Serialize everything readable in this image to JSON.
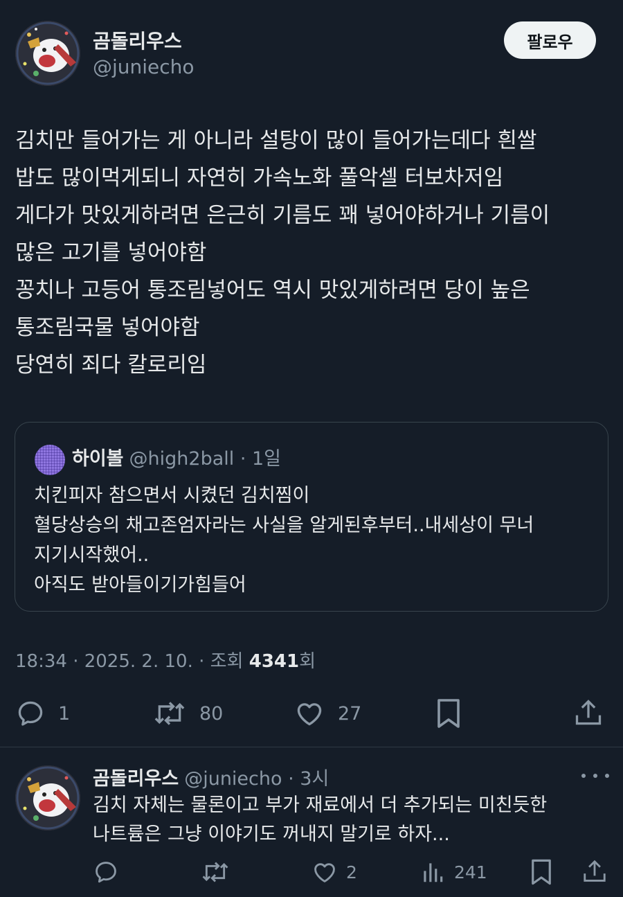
{
  "author": {
    "name": "곰돌리우스",
    "handle": "@juniecho"
  },
  "follow_label": "팔로우",
  "tweet_lines": [
    "김치만 들어가는 게 아니라 설탕이 많이 들어가는데다 흰쌀",
    "밥도 많이먹게되니 자연히 가속노화 풀악셀 터보차저임",
    "게다가 맛있게하려면 은근히 기름도 꽤 넣어야하거나 기름이",
    "많은 고기를 넣어야함",
    "꽁치나 고등어 통조림넣어도 역시 맛있게하려면 당이 높은",
    "통조림국물 넣어야함",
    "당연히 죄다 칼로리임"
  ],
  "quote": {
    "name": "하이볼",
    "meta": "@high2ball · 1일",
    "lines": [
      "치킨피자 참으면서 시켰던 김치찜이",
      "혈당상승의 채고존엄자라는 사실을 알게된후부터..내세상이 무너",
      "지기시작했어..",
      "아직도 받아들이기가힘들어"
    ]
  },
  "meta": {
    "prefix": "18:34 · 2025. 2. 10. · 조회 ",
    "views": "4341",
    "suffix": "회"
  },
  "actions": {
    "reply": "1",
    "repost": "80",
    "like": "27"
  },
  "reply": {
    "name": "곰돌리우스",
    "meta": "@juniecho · 3시",
    "lines": [
      "김치 자체는 물론이고 부가 재료에서 더 추가되는 미친듯한",
      "나트륨은 그냥 이야기도 꺼내지 말기로 하자..."
    ],
    "actions": {
      "like": "2",
      "views": "241"
    }
  },
  "colors": {
    "background": "#151d28",
    "text": "#e7e9ea",
    "muted": "#8b98a5",
    "border": "#38444d"
  }
}
